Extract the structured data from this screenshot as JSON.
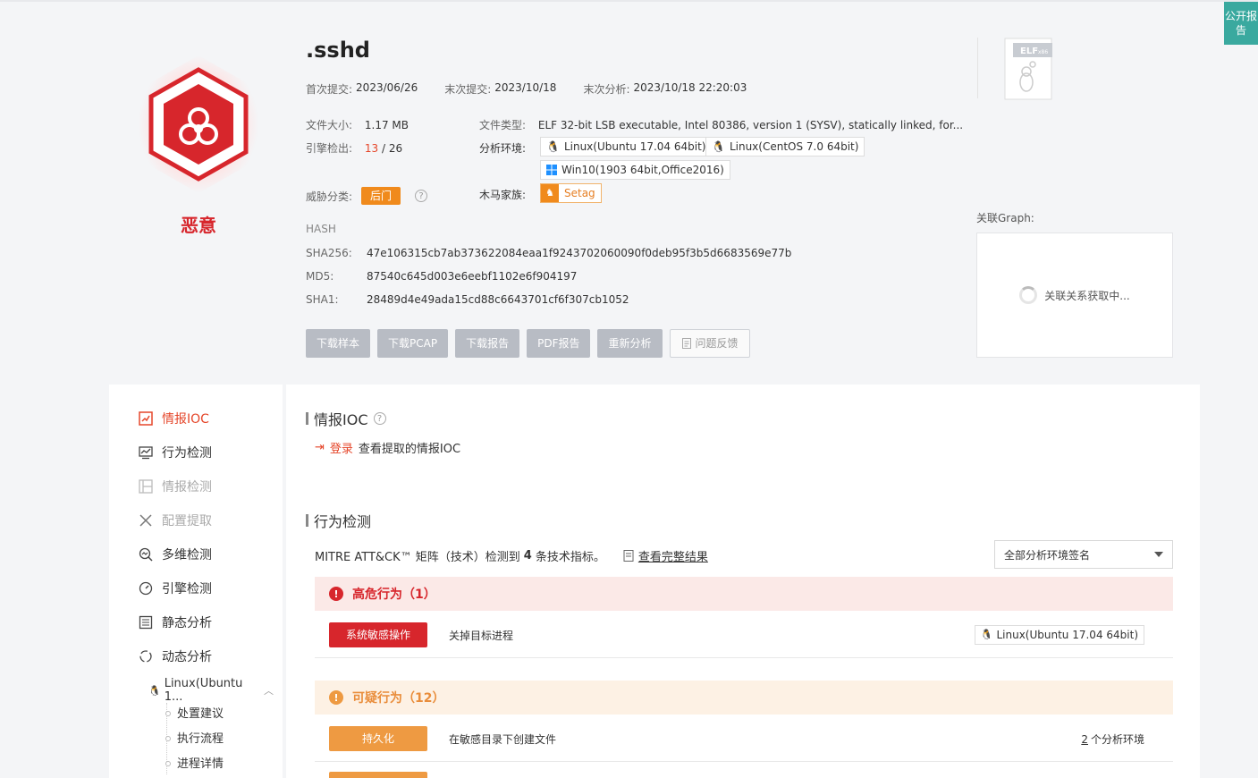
{
  "public_report": "公开报告",
  "verdict": {
    "label": "恶意"
  },
  "file": {
    "name": ".sshd",
    "first_submit_label": "首次提交:",
    "first_submit": "2023/06/26",
    "last_submit_label": "末次提交:",
    "last_submit": "2023/10/18",
    "last_analysis_label": "末次分析:",
    "last_analysis": "2023/10/18 22:20:03",
    "size_label": "文件大小:",
    "size": "1.17 MB",
    "type_label": "文件类型:",
    "type": "ELF 32-bit LSB executable, Intel 80386, version 1 (SYSV), statically linked, for...",
    "engines_label": "引擎检出:",
    "engines_detected": "13",
    "engines_total": " / 26",
    "env_label": "分析环境:",
    "envs": [
      "Linux(Ubuntu 17.04 64bit)",
      "Linux(CentOS 7.0 64bit)",
      "Win10(1903 64bit,Office2016)"
    ],
    "threat_label": "威胁分类:",
    "threat": "后门",
    "family_label": "木马家族:",
    "family": "Setag",
    "filetype_icon": "ELF",
    "filetype_sub": "x86"
  },
  "hash": {
    "title": "HASH",
    "sha256_label": "SHA256:",
    "sha256": "47e106315cb7ab373622084eaa1f9243702060090f0deb95f3b5d6683569e77b",
    "md5_label": "MD5:",
    "md5": "87540c645d003e6eebf1102e6f904197",
    "sha1_label": "SHA1:",
    "sha1": "28489d4e49ada15cd88c6643701cf6f307cb1052"
  },
  "actions": {
    "download_sample": "下载样本",
    "download_pcap": "下载PCAP",
    "download_report": "下载报告",
    "pdf_report": "PDF报告",
    "reanalyze": "重新分析",
    "feedback": "问题反馈"
  },
  "graph": {
    "label": "关联Graph:",
    "loading": "关联关系获取中..."
  },
  "sidebar": {
    "items": [
      {
        "label": "情报IOC"
      },
      {
        "label": "行为检测"
      },
      {
        "label": "情报检测"
      },
      {
        "label": "配置提取"
      },
      {
        "label": "多维检测"
      },
      {
        "label": "引擎检测"
      },
      {
        "label": "静态分析"
      },
      {
        "label": "动态分析"
      }
    ],
    "env_item": "Linux(Ubuntu 1...",
    "subitems": [
      "处置建议",
      "执行流程",
      "进程详情"
    ]
  },
  "ioc": {
    "title": "情报IOC",
    "login": "登录",
    "hint": "查看提取的情报IOC"
  },
  "behavior": {
    "title": "行为检测",
    "mitre_prefix": "MITRE ATT&CK™ 矩阵（技术）检测到",
    "mitre_count": "4",
    "mitre_suffix": "条技术指标。",
    "view_full": "查看完整结果",
    "select_value": "全部分析环境签名",
    "high_title": "高危行为（1）",
    "high_rows": [
      {
        "tag": "系统敏感操作",
        "desc": "关掉目标进程",
        "env": "Linux(Ubuntu 17.04 64bit)"
      }
    ],
    "sus_title": "可疑行为（12）",
    "sus_rows": [
      {
        "tag": "持久化",
        "desc": "在敏感目录下创建文件",
        "env_count": "2",
        "env_count_suffix": "个分析环境"
      }
    ]
  },
  "colors": {
    "accent": "#e5462a",
    "danger": "#d7262c",
    "warning": "#f08a1c",
    "teal": "#3aa99f"
  }
}
